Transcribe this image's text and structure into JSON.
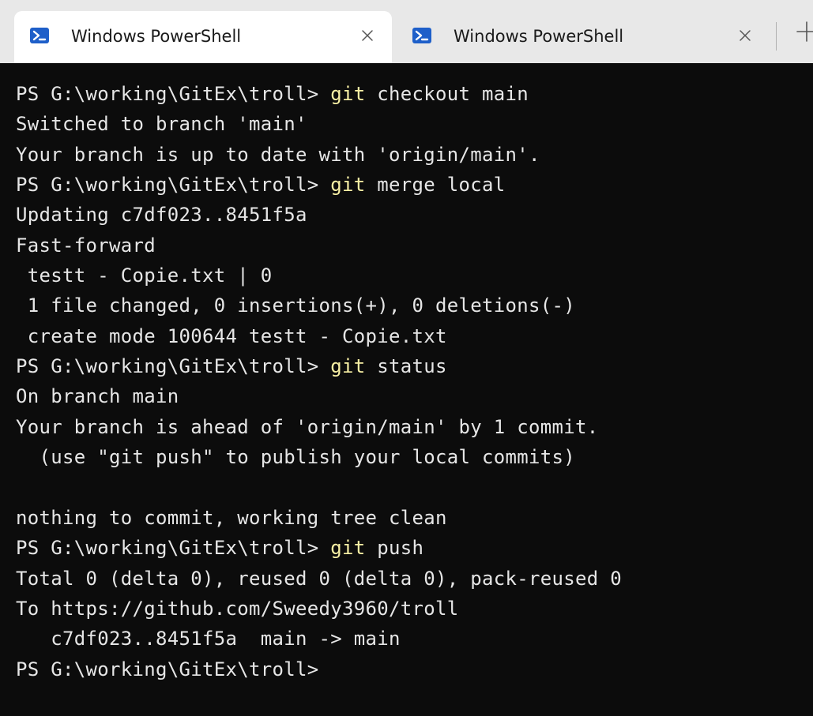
{
  "tabs": [
    {
      "title": "Windows PowerShell",
      "active": true
    },
    {
      "title": "Windows PowerShell",
      "active": false
    }
  ],
  "icons": {
    "tab_icon": "powershell-icon",
    "close": "close-icon",
    "new_tab": "plus-icon"
  },
  "colors": {
    "terminal_bg": "#0c0c0c",
    "text": "#e6e6e6",
    "command_highlight": "#f9f1a5",
    "tab_icon": "#1e5fc9"
  },
  "terminal": {
    "lines": [
      {
        "prompt": "PS G:\\working\\GitEx\\troll> ",
        "cmd": "git",
        "args": " checkout main"
      },
      {
        "text": "Switched to branch 'main'"
      },
      {
        "text": "Your branch is up to date with 'origin/main'."
      },
      {
        "prompt": "PS G:\\working\\GitEx\\troll> ",
        "cmd": "git",
        "args": " merge local"
      },
      {
        "text": "Updating c7df023..8451f5a"
      },
      {
        "text": "Fast-forward"
      },
      {
        "text": " testt - Copie.txt | 0"
      },
      {
        "text": " 1 file changed, 0 insertions(+), 0 deletions(-)"
      },
      {
        "text": " create mode 100644 testt - Copie.txt"
      },
      {
        "prompt": "PS G:\\working\\GitEx\\troll> ",
        "cmd": "git",
        "args": " status"
      },
      {
        "text": "On branch main"
      },
      {
        "text": "Your branch is ahead of 'origin/main' by 1 commit."
      },
      {
        "text": "  (use \"git push\" to publish your local commits)"
      },
      {
        "text": ""
      },
      {
        "text": "nothing to commit, working tree clean"
      },
      {
        "prompt": "PS G:\\working\\GitEx\\troll> ",
        "cmd": "git",
        "args": " push"
      },
      {
        "text": "Total 0 (delta 0), reused 0 (delta 0), pack-reused 0"
      },
      {
        "text": "To https://github.com/Sweedy3960/troll"
      },
      {
        "text": "   c7df023..8451f5a  main -> main"
      },
      {
        "prompt": "PS G:\\working\\GitEx\\troll>",
        "cmd": "",
        "args": ""
      }
    ]
  }
}
